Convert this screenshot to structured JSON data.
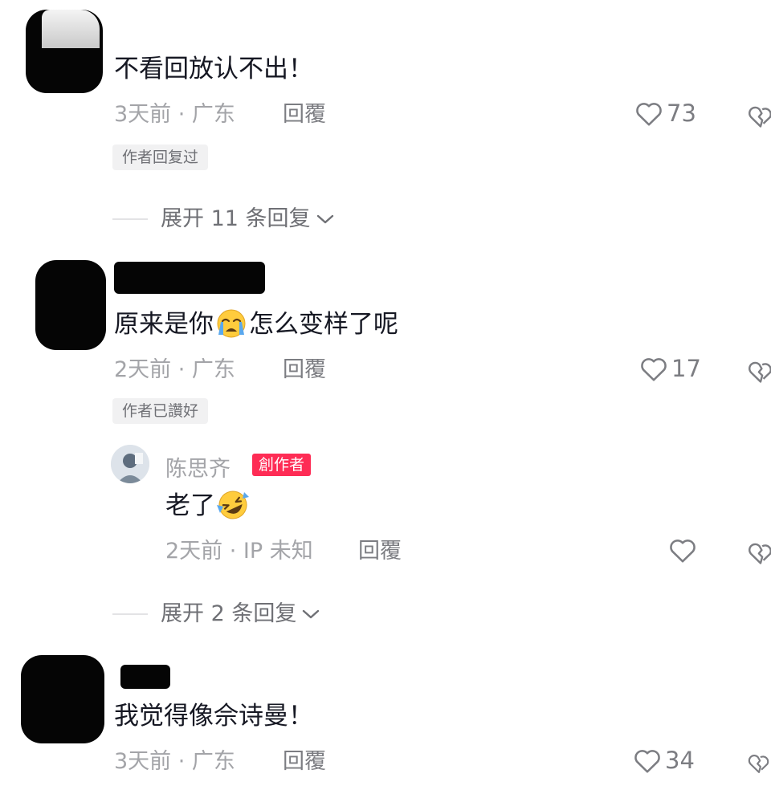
{
  "comments": [
    {
      "text": "不看回放认不出！",
      "meta": "3天前 · 广东",
      "reply_label": "回覆",
      "tag": "作者回复过",
      "likes": "73",
      "expand_label": "展开 11 条回复"
    },
    {
      "text_before": "原来是你",
      "text_after": "怎么变样了呢",
      "meta": "2天前 · 广东",
      "reply_label": "回覆",
      "tag": "作者已讚好",
      "likes": "17",
      "reply": {
        "author": "陈思齐",
        "badge": "創作者",
        "text": "老了",
        "meta": "2天前 · IP 未知",
        "reply_label": "回覆",
        "likes": ""
      },
      "expand_label": "展开 2 条回复"
    },
    {
      "text": "我觉得像佘诗曼！",
      "meta": "3天前 · 广东",
      "reply_label": "回覆",
      "likes": "34"
    }
  ],
  "icons": {
    "like": "heart-outline-icon",
    "dislike": "broken-heart-icon",
    "expand": "chevron-down-icon",
    "crying_emoji": "loudly-crying-face-emoji",
    "laughing_emoji": "rolling-on-floor-laughing-emoji"
  },
  "colors": {
    "text": "#161823",
    "meta": "#a3a4a8",
    "creator_badge": "#fe2c55",
    "tag_bg": "#f1f1f2"
  }
}
